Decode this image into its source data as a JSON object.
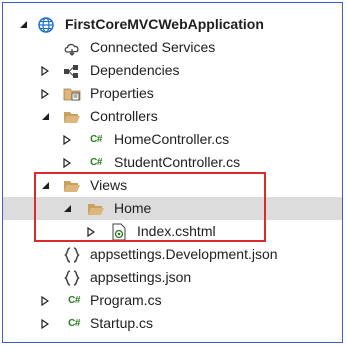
{
  "tree": {
    "project": "FirstCoreMVCWebApplication",
    "connected_services": "Connected Services",
    "dependencies": "Dependencies",
    "properties": "Properties",
    "controllers": "Controllers",
    "home_controller": "HomeController.cs",
    "student_controller": "StudentController.cs",
    "views": "Views",
    "home": "Home",
    "index": "Index.cshtml",
    "appsettings_dev": "appsettings.Development.json",
    "appsettings": "appsettings.json",
    "program": "Program.cs",
    "startup": "Startup.cs",
    "cs_badge": "C#"
  },
  "colors": {
    "frame_border": "#3a5fcd",
    "highlight_border": "#d92b2b",
    "selection": "#dcdcdc",
    "folder": "#dcb67a",
    "csharp": "#2b7a1f"
  }
}
